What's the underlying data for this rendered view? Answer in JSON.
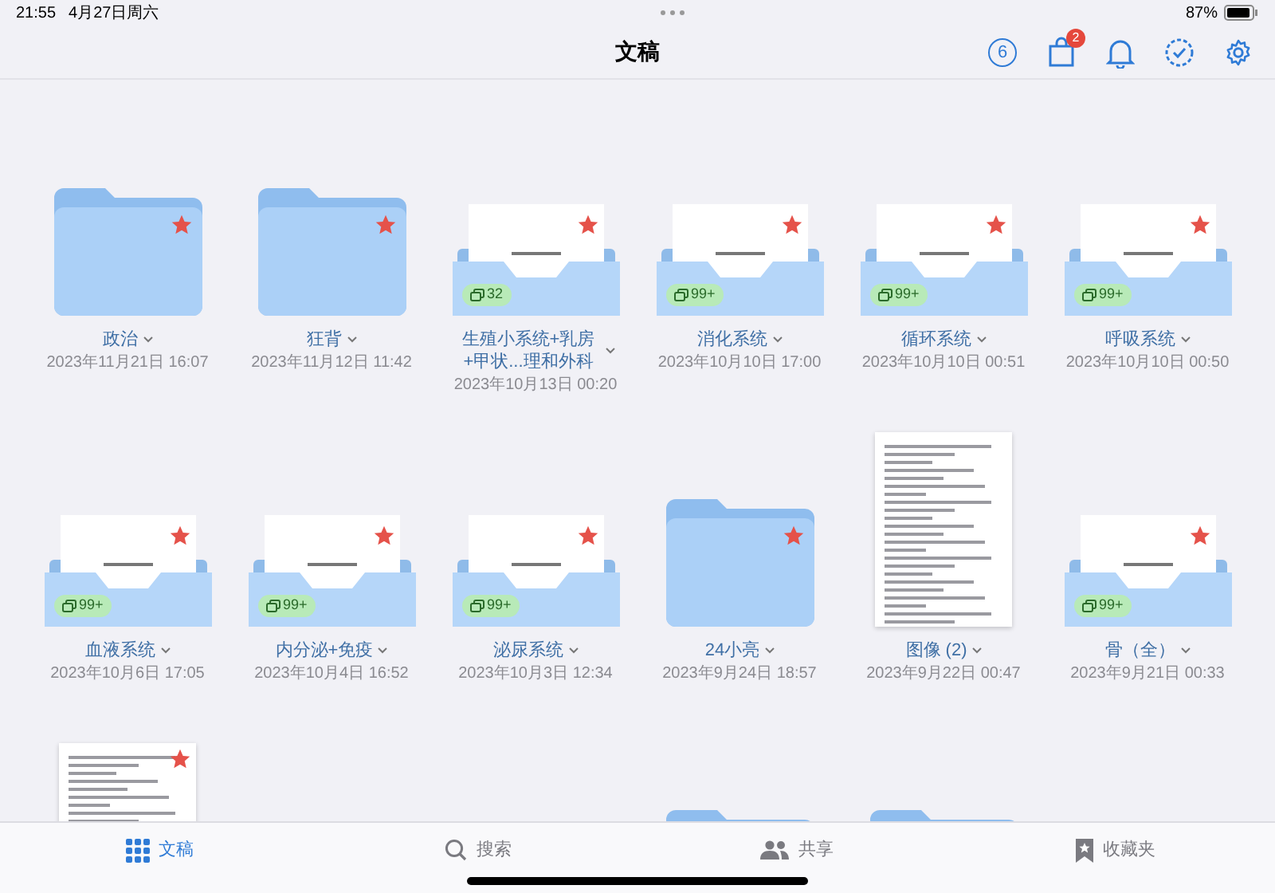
{
  "status_bar": {
    "time": "21:55",
    "date": "4月27日周六",
    "battery": "87%"
  },
  "nav_bar": {
    "title": "文稿",
    "counter": "6",
    "notification_badge": "2"
  },
  "items": [
    {
      "kind": "folder",
      "name": "政治",
      "date": "2023年11月21日 16:07",
      "starred": true
    },
    {
      "kind": "folder",
      "name": "狂背",
      "date": "2023年11月12日 11:42",
      "starred": true
    },
    {
      "kind": "stack",
      "name": "生殖小系统+乳房+甲状...理和外科",
      "date": "2023年10月13日 00:20",
      "starred": true,
      "count": "32"
    },
    {
      "kind": "stack",
      "name": "消化系统",
      "date": "2023年10月10日 17:00",
      "starred": true,
      "count": "99+"
    },
    {
      "kind": "stack",
      "name": "循环系统",
      "date": "2023年10月10日 00:51",
      "starred": true,
      "count": "99+"
    },
    {
      "kind": "stack",
      "name": "呼吸系统",
      "date": "2023年10月10日 00:50",
      "starred": true,
      "count": "99+"
    },
    {
      "kind": "stack",
      "name": "血液系统",
      "date": "2023年10月6日 17:05",
      "starred": true,
      "count": "99+"
    },
    {
      "kind": "stack",
      "name": "内分泌+免疫",
      "date": "2023年10月4日 16:52",
      "starred": true,
      "count": "99+"
    },
    {
      "kind": "stack",
      "name": "泌尿系统",
      "date": "2023年10月3日 12:34",
      "starred": true,
      "count": "99+"
    },
    {
      "kind": "folder",
      "name": "24小亮",
      "date": "2023年9月24日 18:57",
      "starred": true
    },
    {
      "kind": "document",
      "name": "图像 (2)",
      "date": "2023年9月22日 00:47"
    },
    {
      "kind": "stack",
      "name": "骨（全）",
      "date": "2023年9月21日 00:33",
      "starred": true,
      "count": "99+"
    },
    {
      "kind": "document",
      "starred": true
    },
    {
      "kind": "empty"
    },
    {
      "kind": "empty"
    },
    {
      "kind": "folder"
    },
    {
      "kind": "folder"
    }
  ],
  "tab_bar": [
    {
      "label": "文稿",
      "selected": true
    },
    {
      "label": "搜索",
      "selected": false
    },
    {
      "label": "共享",
      "selected": false
    },
    {
      "label": "收藏夹",
      "selected": false
    }
  ]
}
